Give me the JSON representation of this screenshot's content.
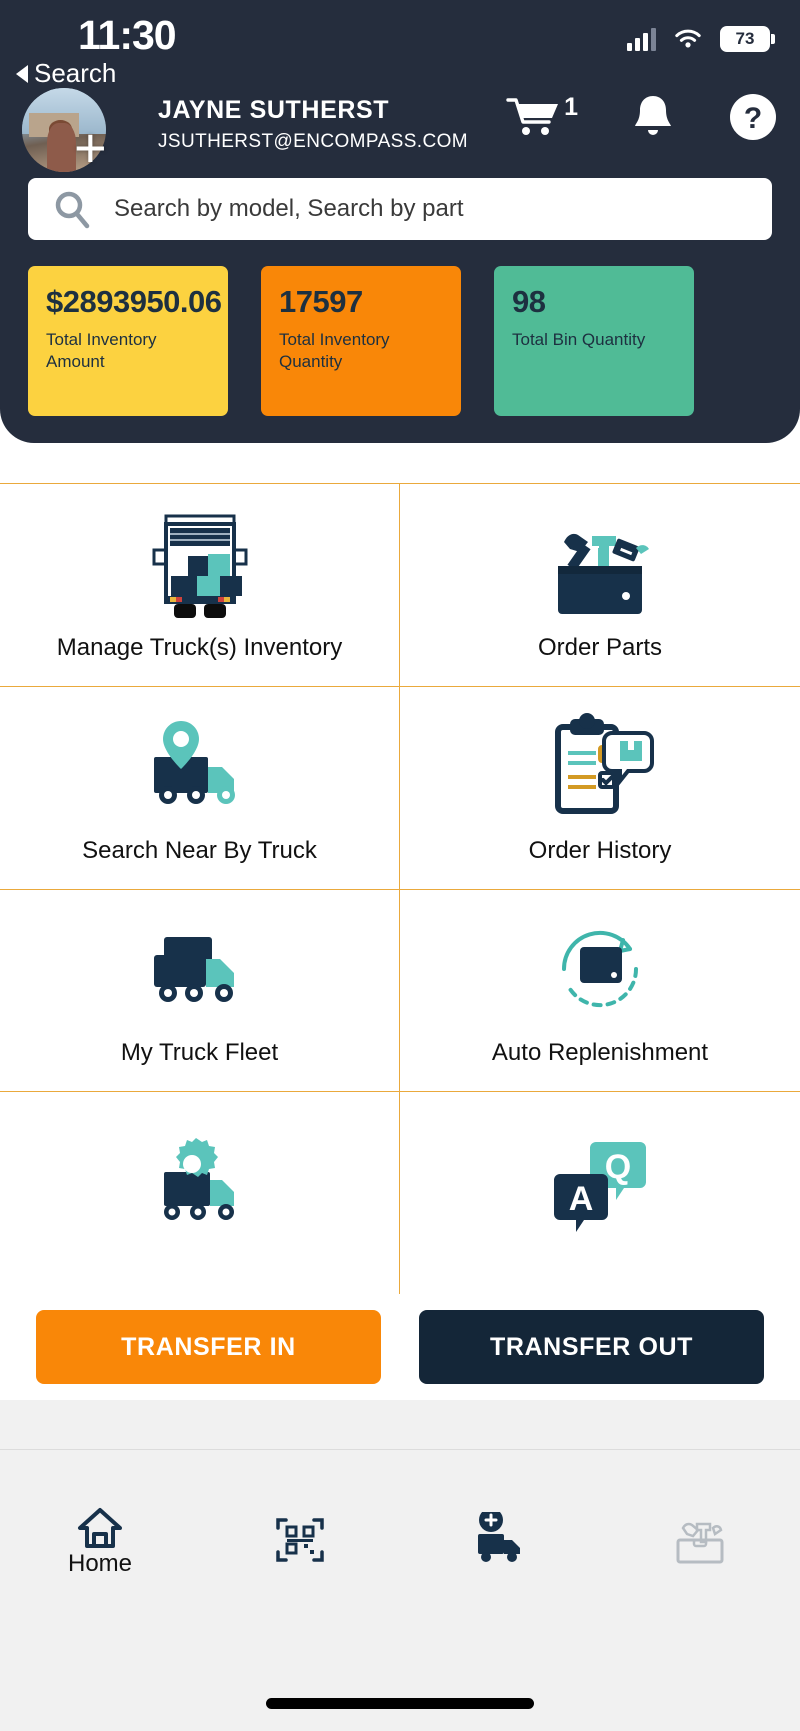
{
  "status_bar": {
    "time": "11:30",
    "battery_level": "73",
    "signal_icon": "cellular-signal-icon",
    "wifi_icon": "wifi-icon",
    "battery_icon": "battery-icon"
  },
  "back_link": {
    "label": "Search",
    "icon": "back-triangle-icon"
  },
  "user": {
    "name": "JAYNE SUTHERST",
    "email": "JSUTHERST@ENCOMPASS.COM",
    "avatar_icon": "user-avatar",
    "add_icon": "plus-icon"
  },
  "header_actions": {
    "cart_icon": "shopping-cart-icon",
    "cart_count": "1",
    "bell_icon": "notification-bell-icon",
    "help_icon": "help-question-icon"
  },
  "search": {
    "placeholder": "Search by model, Search by part",
    "value": "",
    "icon": "search-icon"
  },
  "stats": [
    {
      "value": "$2893950.06",
      "label": "Total Inventory Amount",
      "color": "#fcd240"
    },
    {
      "value": "17597",
      "label": "Total Inventory Quantity",
      "color": "#f98708"
    },
    {
      "value": "98",
      "label": "Total Bin Quantity",
      "color": "#50bb96"
    }
  ],
  "menu_items": [
    {
      "label": "Manage Truck(s) Inventory",
      "icon": "truck-with-boxes-icon"
    },
    {
      "label": "Order Parts",
      "icon": "toolbox-with-tools-icon"
    },
    {
      "label": "Search Near By Truck",
      "icon": "truck-location-pin-icon"
    },
    {
      "label": "Order History",
      "icon": "clipboard-checklist-icon"
    },
    {
      "label": "My Truck Fleet",
      "icon": "multiple-trucks-icon"
    },
    {
      "label": "Auto Replenishment",
      "icon": "box-refresh-arrow-icon"
    },
    {
      "label": "",
      "icon": "truck-gear-icon"
    },
    {
      "label": "",
      "icon": "question-answer-chat-icon"
    }
  ],
  "transfer_buttons": {
    "transfer_in": "TRANSFER IN",
    "transfer_out": "TRANSFER OUT"
  },
  "bottom_nav": [
    {
      "label": "Home",
      "icon": "home-icon",
      "active": true
    },
    {
      "label": "",
      "icon": "qr-scanner-icon",
      "active": false
    },
    {
      "label": "",
      "icon": "add-truck-icon",
      "active": false
    },
    {
      "label": "",
      "icon": "toolbox-icon",
      "active": false
    }
  ],
  "colors": {
    "header_bg": "#252d3d",
    "accent_orange": "#f98708",
    "accent_yellow": "#fcd240",
    "accent_green": "#50bb96",
    "grid_border": "#eaa93c",
    "navy": "#142638",
    "teal": "#5bc4bb"
  }
}
